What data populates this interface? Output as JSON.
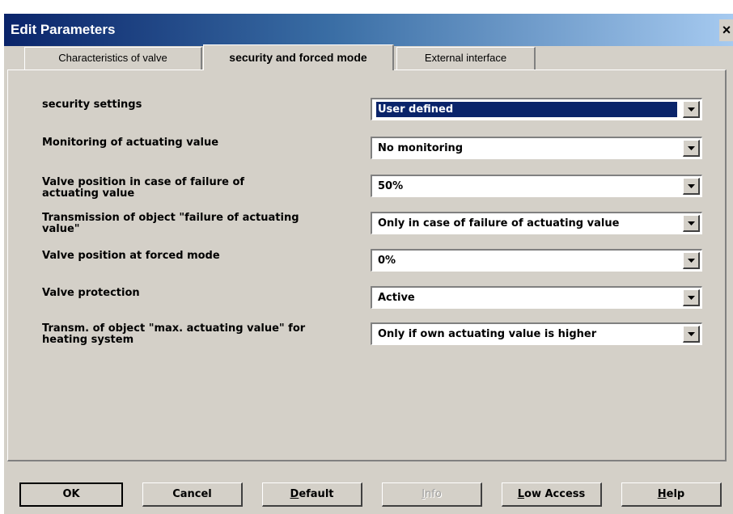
{
  "window": {
    "title": "Edit Parameters",
    "close_glyph": "×"
  },
  "tabs": [
    {
      "label": "Characteristics of valve"
    },
    {
      "label": "security and forced mode"
    },
    {
      "label": "External interface"
    }
  ],
  "rows": [
    {
      "label": "security settings",
      "value": "User defined"
    },
    {
      "label": "Monitoring of actuating value",
      "value": "No monitoring"
    },
    {
      "label": "Valve position in case of failure of actuating value",
      "value": "50%"
    },
    {
      "label": "Transmission of object \"failure of actuating value\"",
      "value": "Only in case of failure of actuating value"
    },
    {
      "label": "Valve position at forced mode",
      "value": "0%"
    },
    {
      "label": "Valve protection",
      "value": "Active"
    },
    {
      "label": "Transm. of object \"max. actuating value\" for heating system",
      "value": "Only if own actuating value is higher"
    }
  ],
  "buttons": {
    "ok": "OK",
    "cancel": "Cancel",
    "default_accel": "D",
    "default_rest": "efault",
    "info_accel": "I",
    "info_rest": "nfo",
    "low_access_accel": "L",
    "low_access_rest": "ow Access",
    "help_accel": "H",
    "help_rest": "elp"
  },
  "icons": {
    "dropdown": "chevron-down-icon",
    "close": "close-icon"
  },
  "colors": {
    "selection": "#0a246a",
    "face": "#d4d0c8",
    "title_start": "#0a246a"
  }
}
